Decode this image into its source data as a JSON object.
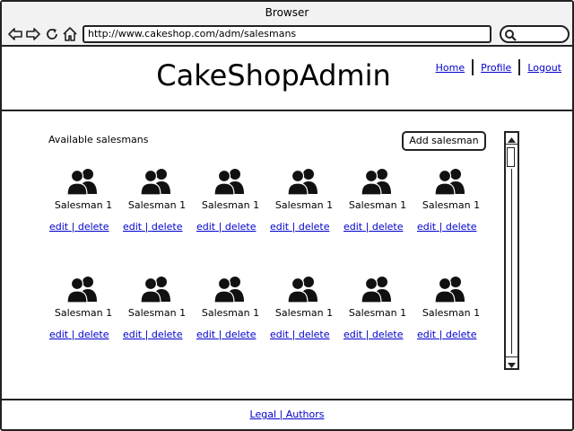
{
  "browser": {
    "title": "Browser",
    "url": "http://www.cakeshop.com/adm/salesmans"
  },
  "header": {
    "site_title": "CakeShopAdmin",
    "links": [
      "Home",
      "Profile",
      "Logout"
    ]
  },
  "main": {
    "section_label": "Available salesmans",
    "add_button_label": "Add salesman",
    "salesmen": [
      {
        "name": "Salesman 1",
        "edit": "edit",
        "delete": "delete"
      },
      {
        "name": "Salesman 1",
        "edit": "edit",
        "delete": "delete"
      },
      {
        "name": "Salesman 1",
        "edit": "edit",
        "delete": "delete"
      },
      {
        "name": "Salesman 1",
        "edit": "edit",
        "delete": "delete"
      },
      {
        "name": "Salesman 1",
        "edit": "edit",
        "delete": "delete"
      },
      {
        "name": "Salesman 1",
        "edit": "edit",
        "delete": "delete"
      },
      {
        "name": "Salesman 1",
        "edit": "edit",
        "delete": "delete"
      },
      {
        "name": "Salesman 1",
        "edit": "edit",
        "delete": "delete"
      },
      {
        "name": "Salesman 1",
        "edit": "edit",
        "delete": "delete"
      },
      {
        "name": "Salesman 1",
        "edit": "edit",
        "delete": "delete"
      },
      {
        "name": "Salesman 1",
        "edit": "edit",
        "delete": "delete"
      },
      {
        "name": "Salesman 1",
        "edit": "edit",
        "delete": "delete"
      }
    ],
    "separator": "|"
  },
  "footer": {
    "text": "Legal | Authors"
  },
  "icons": {
    "back": "arrow-left-icon",
    "forward": "arrow-right-icon",
    "reload": "reload-icon",
    "home": "home-icon",
    "search": "search-icon",
    "user_group": "users-icon"
  },
  "colors": {
    "link": "#0000cc",
    "border": "#222222"
  }
}
